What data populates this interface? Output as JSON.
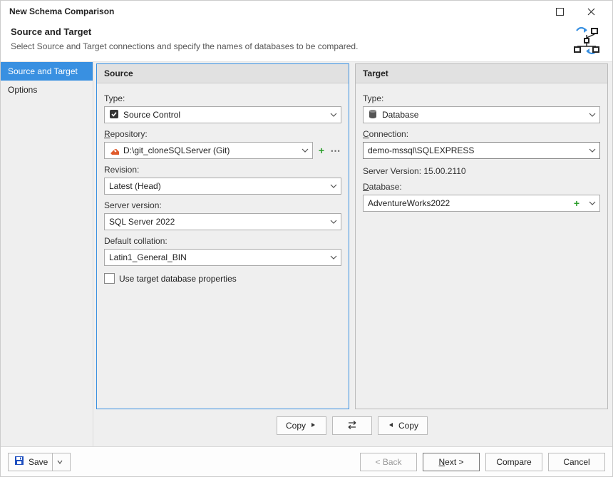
{
  "window": {
    "title": "New Schema Comparison"
  },
  "header": {
    "title": "Source and Target",
    "subtitle": "Select Source and Target connections and specify the names of databases to be compared."
  },
  "sidebar": {
    "items": [
      {
        "label": "Source and Target",
        "selected": true
      },
      {
        "label": "Options",
        "selected": false
      }
    ]
  },
  "source": {
    "title": "Source",
    "type_label": "Type:",
    "type_value": "Source Control",
    "repo_label_pre": "R",
    "repo_label_post": "epository:",
    "repo_value": "D:\\git_cloneSQLServer (Git)",
    "rev_label": "Revision:",
    "rev_value": "Latest (Head)",
    "srvver_label": "Server version:",
    "srvver_value": "SQL Server 2022",
    "collation_label": "Default collation:",
    "collation_value": "Latin1_General_BIN",
    "usetarget_label": "Use target database properties"
  },
  "target": {
    "title": "Target",
    "type_label": "Type:",
    "type_value": "Database",
    "conn_label_pre": "C",
    "conn_label_post": "onnection:",
    "conn_value": "demo-mssql\\SQLEXPRESS",
    "server_version_label": "Server Version: 15.00.2110",
    "db_label_pre": "D",
    "db_label_post": "atabase:",
    "db_value": "AdventureWorks2022"
  },
  "mid": {
    "copy_right": "Copy",
    "copy_left": "Copy"
  },
  "footer": {
    "save": "Save",
    "back": "< Back",
    "next_pre": "N",
    "next_post": "ext >",
    "compare": "Compare",
    "cancel": "Cancel"
  }
}
